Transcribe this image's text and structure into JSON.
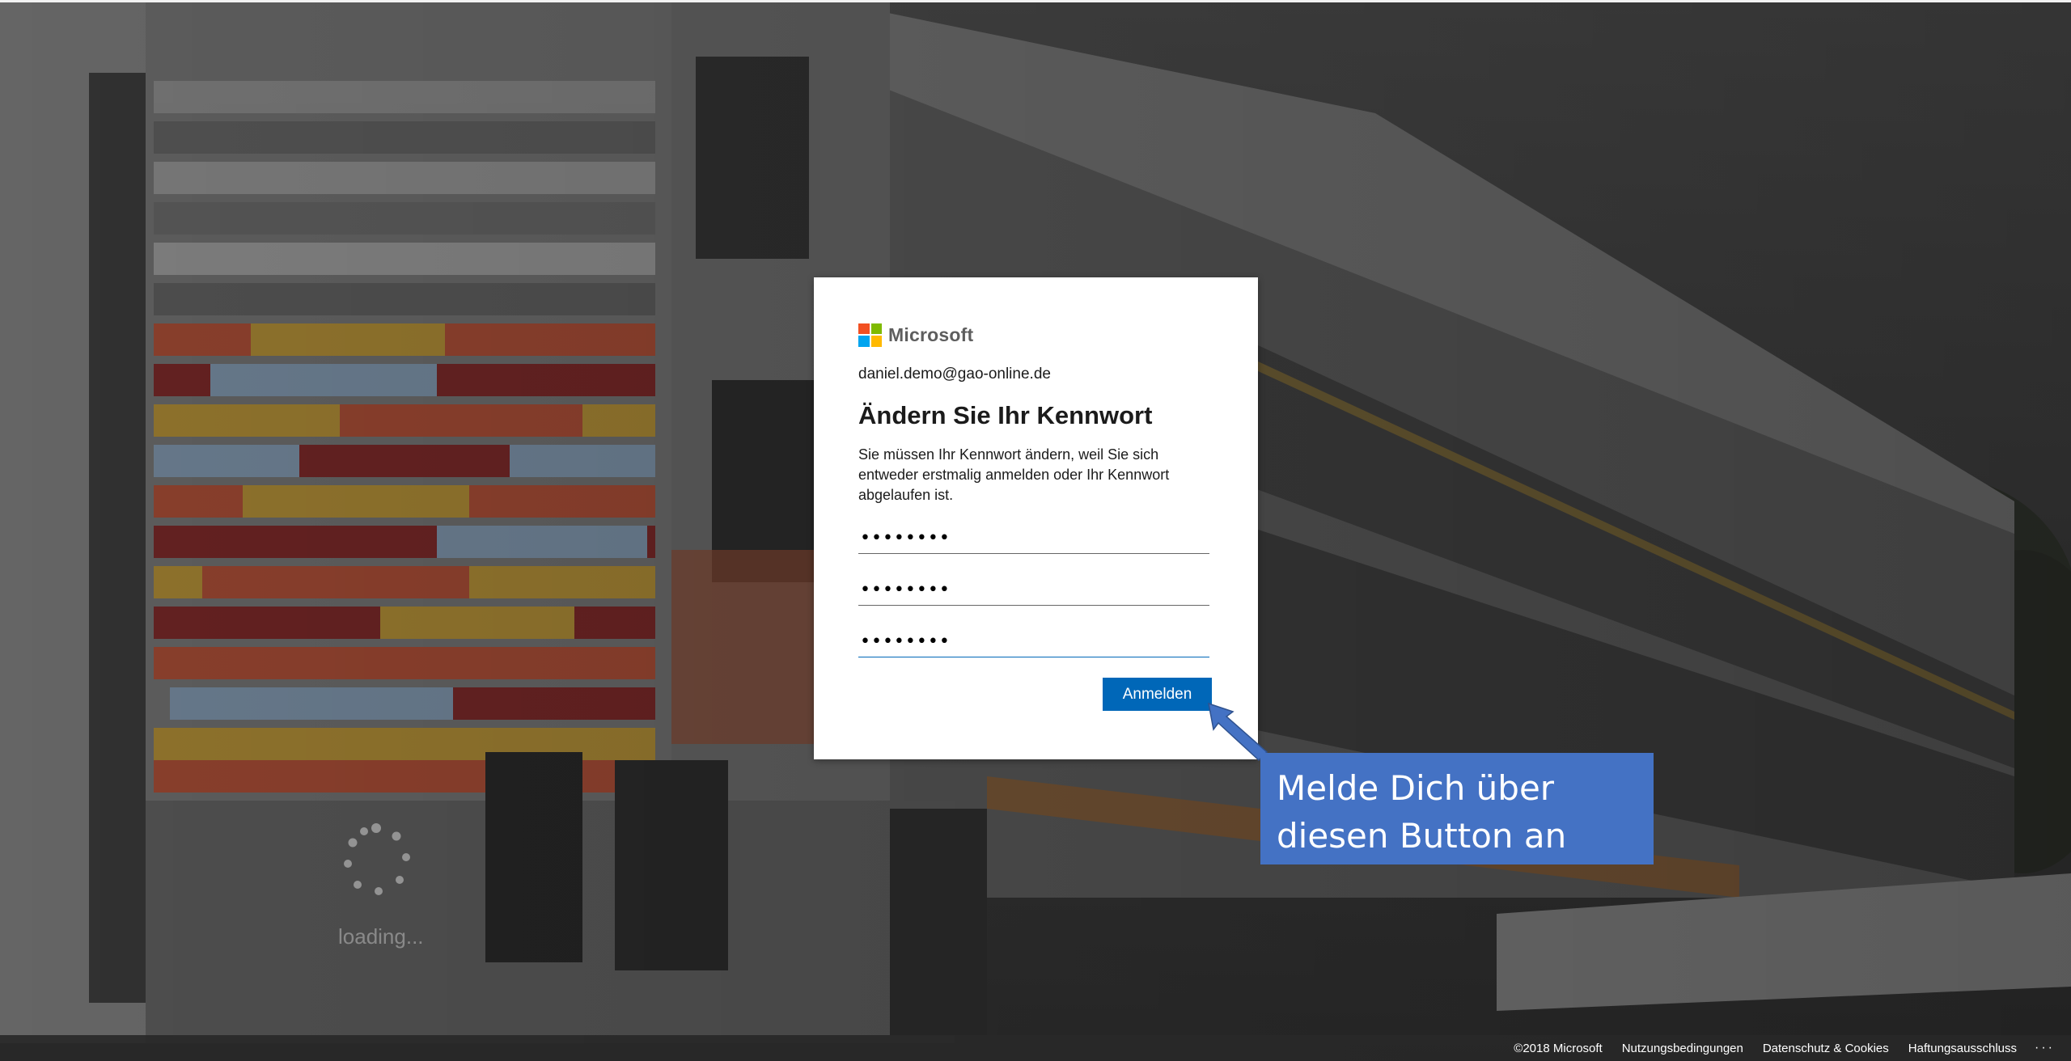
{
  "login": {
    "brand": "Microsoft",
    "identity": "daniel.demo@gao-online.de",
    "title": "Ändern Sie Ihr Kennwort",
    "description": "Sie müssen Ihr Kennwort ändern, weil Sie sich entweder erstmalig anmelden oder Ihr Kennwort abgelaufen ist.",
    "fields": [
      {
        "name": "current-password",
        "value": "••••••••"
      },
      {
        "name": "new-password",
        "value": "••••••••"
      },
      {
        "name": "confirm-password",
        "value": "••••••••"
      }
    ],
    "submit_label": "Anmelden"
  },
  "annotation": {
    "line1": "Melde Dich über",
    "line2": "diesen Button an",
    "color": "#4472c4"
  },
  "loading": {
    "label": "loading..."
  },
  "footer": {
    "copyright": "©2018 Microsoft",
    "terms": "Nutzungsbedingungen",
    "privacy": "Datenschutz & Cookies",
    "disclaimer": "Haftungsausschluss",
    "more": "···"
  },
  "colors": {
    "accent": "#0067b8",
    "ms_red": "#f25022",
    "ms_green": "#7fba00",
    "ms_blue": "#00a4ef",
    "ms_yellow": "#ffb900"
  }
}
